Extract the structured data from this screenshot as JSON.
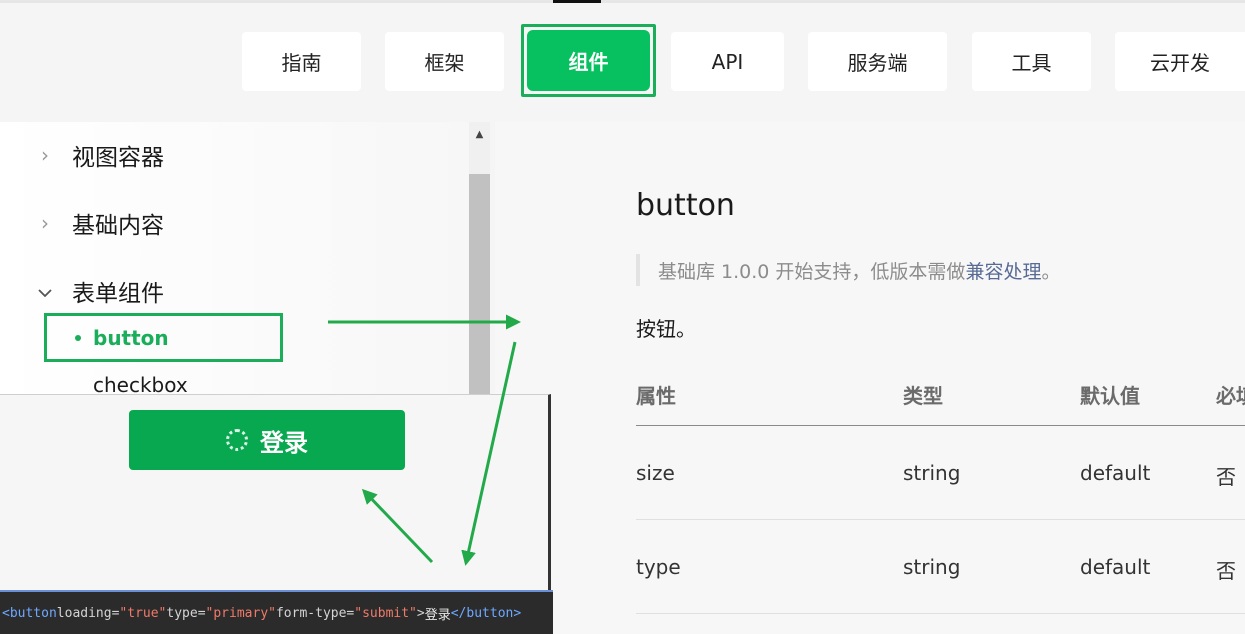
{
  "nav": {
    "tabs": [
      {
        "label": "指南"
      },
      {
        "label": "框架"
      },
      {
        "label": "组件",
        "active": true
      },
      {
        "label": "API"
      },
      {
        "label": "服务端"
      },
      {
        "label": "工具"
      },
      {
        "label": "云开发"
      }
    ]
  },
  "sidebar": {
    "categories": [
      {
        "label": "视图容器",
        "expanded": false
      },
      {
        "label": "基础内容",
        "expanded": false
      },
      {
        "label": "表单组件",
        "expanded": true
      }
    ],
    "items": [
      {
        "label": "button",
        "active": true
      },
      {
        "label": "checkbox"
      }
    ]
  },
  "content": {
    "title": "button",
    "note_prefix": "基础库 1.0.0 开始支持，低版本需做",
    "note_link": "兼容处理",
    "note_suffix": "。",
    "description": "按钮。",
    "table": {
      "headers": [
        "属性",
        "类型",
        "默认值",
        "必填"
      ],
      "rows": [
        [
          "size",
          "string",
          "default",
          "否"
        ],
        [
          "type",
          "string",
          "default",
          "否"
        ]
      ]
    }
  },
  "preview": {
    "button_label": "登录",
    "code": {
      "open_tag": "<button",
      "attr1": " loading=",
      "val1": "\"true\"",
      "attr2": " type=",
      "val2": "\"primary\"",
      "attr3": " form-type=",
      "val3": "\"submit\"",
      "close_open": ">",
      "text": "登录",
      "close_tag": "</button>"
    }
  },
  "colors": {
    "accent": "#07c160",
    "highlight_outline": "#1aad5a",
    "link": "#576b95"
  }
}
